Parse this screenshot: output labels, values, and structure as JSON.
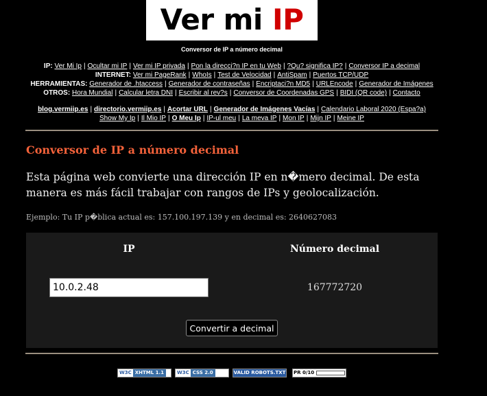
{
  "logo": {
    "part1": "Ver mi ",
    "part2": "IP"
  },
  "subtitle": "Conversor de IP a número decimal",
  "nav": {
    "ip": {
      "label": "IP:",
      "links": [
        "Ver Mi Ip",
        "Ocultar mi IP",
        "Ver mi IP privada",
        "Pon la direcci?n IP en tu Web",
        "?Qu? significa IP?",
        "Conversor IP a decimal"
      ]
    },
    "internet": {
      "label": "INTERNET:",
      "links": [
        "Ver mi PageRank",
        "WhoIs",
        "Test de Velocidad",
        "AntiSpam",
        "Puertos TCP/UDP"
      ]
    },
    "herramientas": {
      "label": "HERRAMIENTAS:",
      "links": [
        "Generador de .htaccess",
        "Generador de contraseñas",
        "Encriptaci?n MD5",
        "URLEncode",
        "Generador de Imágenes"
      ]
    },
    "otros": {
      "label": "OTROS:",
      "links": [
        "Hora Mundial",
        "Calcular letra DNI",
        "Escribir al rev?s",
        "Conversor de Coordenadas GPS",
        "BIDI (QR code)",
        "Contacto"
      ]
    },
    "row5": {
      "bold": [
        "blog.vermiip.es",
        "directorio.vermiip.es",
        "Acortar URL",
        "Generador de Imágenes Vacías"
      ],
      "normal": [
        "Calendario Laboral 2020 (Espa?a)"
      ]
    },
    "row6": [
      "Show My Ip",
      "Il Mio IP",
      "O Meu Ip",
      "IP-ul meu",
      "La meva IP",
      "Mon IP",
      "Mijn IP",
      "Meine IP"
    ]
  },
  "main": {
    "heading": "Conversor de IP a número decimal",
    "intro": "Esta página web convierte una dirección IP en n�mero decimal. De esta manera es más fácil trabajar con rangos de IPs y geolocalización.",
    "example": "Ejemplo: Tu IP p�blica actual es: 157.100.197.139 y en decimal es: 2640627083",
    "col_ip": "IP",
    "col_decimal": "Número decimal",
    "ip_value": "10.0.2.48",
    "decimal_value": "167772720",
    "convert_button": "Convertir a decimal"
  },
  "badges": {
    "xhtml": {
      "left": "W3C",
      "right": "XHTML 1.1"
    },
    "css": {
      "left": "W3C",
      "right": "CSS 2.0"
    },
    "robots": "VALID ROBOTS.TXT",
    "pr": "PR 0/10"
  },
  "colors": {
    "heading": "#f4623a",
    "logo_accent": "#d00000",
    "background": "#000000"
  }
}
